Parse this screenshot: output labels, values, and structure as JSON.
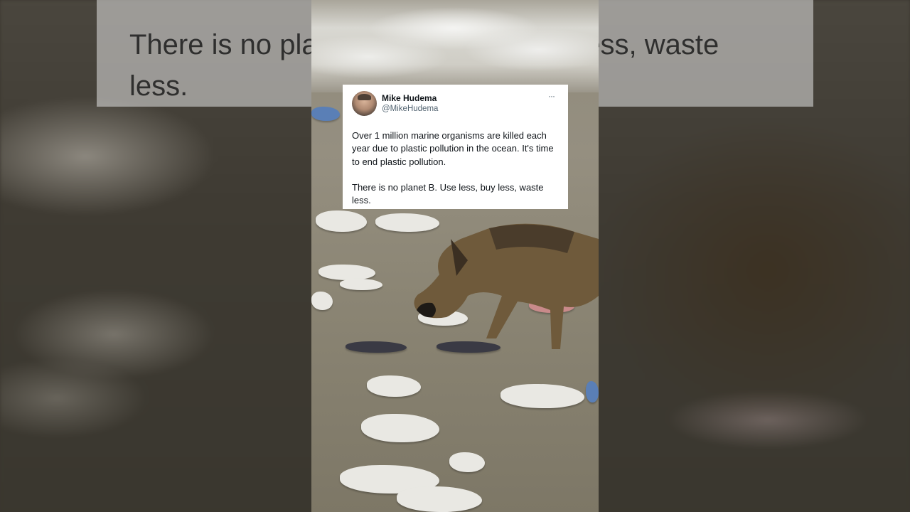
{
  "tweet": {
    "author_name": "Mike Hudema",
    "author_handle": "@MikeHudema",
    "more_icon": "ellipsis-icon",
    "paragraph_1": "Over 1 million marine organisms are killed each year due to plastic pollution in the ocean. It's time to end plastic pollution.",
    "paragraph_2": "There is no planet B. Use less, buy less, waste less."
  },
  "background_caption": {
    "text": "There is no planet B. Use less, buy less, waste\nless."
  },
  "scene": {
    "subject": "dog-walking-in-polluted-water"
  }
}
